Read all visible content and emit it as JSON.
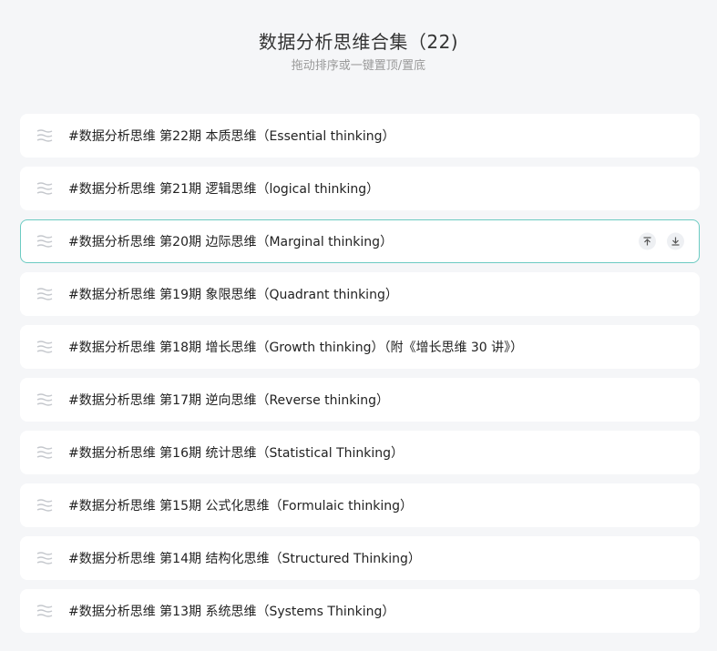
{
  "header": {
    "title": "数据分析思维合集（22)",
    "subtitle": "拖动排序或一键置顶/置底"
  },
  "items": [
    {
      "label": "#数据分析思维 第22期 本质思维（Essential thinking）"
    },
    {
      "label": "#数据分析思维 第21期 逻辑思维（logical thinking）"
    },
    {
      "label": "#数据分析思维 第20期 边际思维（Marginal thinking）"
    },
    {
      "label": "#数据分析思维 第19期 象限思维（Quadrant thinking）"
    },
    {
      "label": "#数据分析思维 第18期 增长思维（Growth thinking）（附《增长思维 30 讲》）"
    },
    {
      "label": "#数据分析思维 第17期 逆向思维（Reverse thinking）"
    },
    {
      "label": "#数据分析思维 第16期 统计思维（Statistical Thinking）"
    },
    {
      "label": "#数据分析思维 第15期 公式化思维（Formulaic thinking）"
    },
    {
      "label": "#数据分析思维 第14期 结构化思维（Structured Thinking）"
    },
    {
      "label": "#数据分析思维 第13期 系统思维（Systems Thinking）"
    }
  ],
  "hovered_item_actions": {
    "move_to_top_icon": "arrow-to-top-icon",
    "move_to_bottom_icon": "arrow-to-bottom-icon"
  },
  "colors": {
    "background": "#f5f6f8",
    "hover_border": "#6ccbc2",
    "drag_handle": "#c4c7cc"
  }
}
